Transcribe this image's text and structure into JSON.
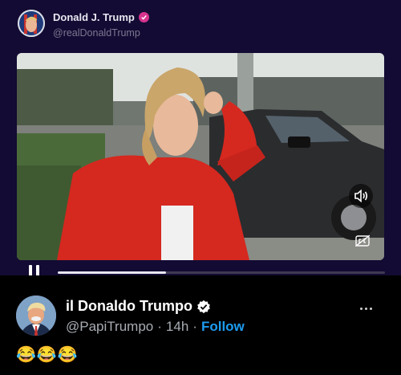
{
  "embedded_post": {
    "display_name": "Donald J. Trump",
    "handle": "@realDonaldTrump"
  },
  "video": {
    "progress": 0.33,
    "volume_icon": "volume-icon",
    "captions_icon": "captions-off-icon",
    "play_state_icon": "pause-icon"
  },
  "post": {
    "display_name": "il Donaldo Trumpo",
    "handle": "@PapiTrumpo",
    "separator": "·",
    "time": "14h",
    "separator2": "·",
    "follow_label": "Follow",
    "text": "😂😂😂"
  },
  "colors": {
    "embed_bg": "#130b33",
    "follow": "#1d9bf0",
    "verified_blue": "#1d9bf0",
    "verified_pink": "#d6338f"
  }
}
